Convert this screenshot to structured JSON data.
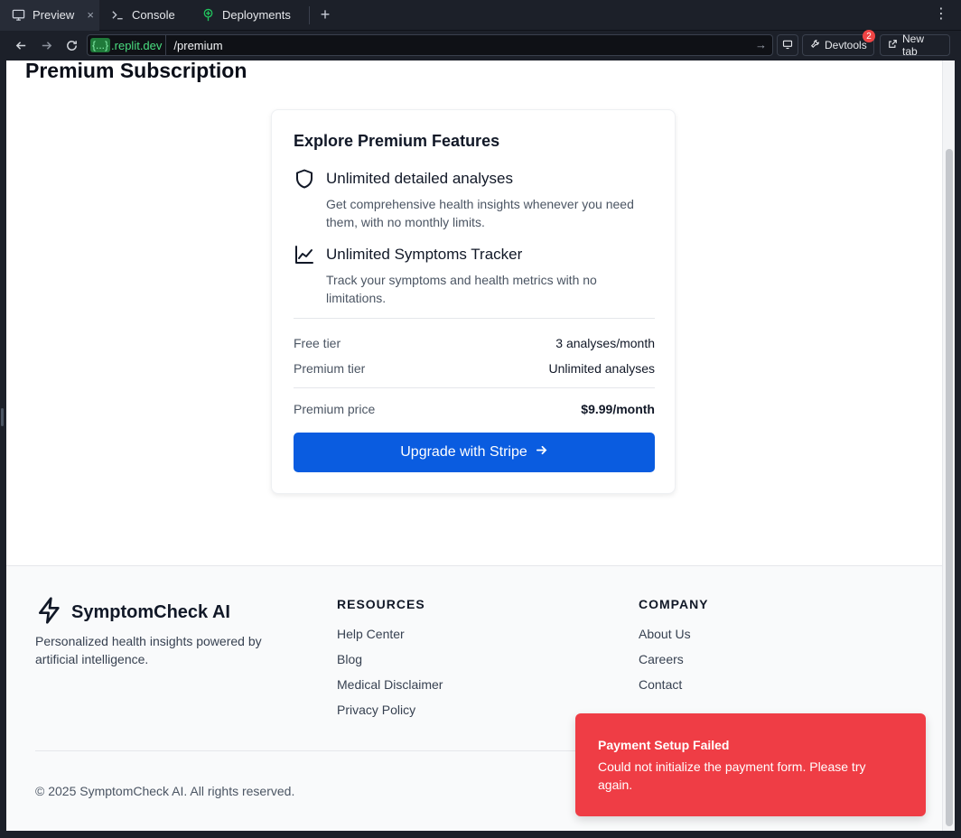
{
  "browser": {
    "tabs": [
      {
        "label": "Preview",
        "icon": "monitor-icon",
        "active": true
      },
      {
        "label": "Console",
        "icon": "terminal-icon",
        "active": false
      },
      {
        "label": "Deployments",
        "icon": "deployments-icon",
        "active": false
      }
    ],
    "close_symbol": "×",
    "new_tab_symbol": "+",
    "menu_symbol": "⋮",
    "domain_braces": "{...}",
    "domain": ".replit.dev",
    "path": "/premium",
    "devtools_label": "Devtools",
    "devtools_badge": "2",
    "new_tab_label": "New tab"
  },
  "page": {
    "title": "Premium Subscription",
    "card": {
      "title": "Explore Premium Features",
      "features": [
        {
          "icon": "shield-icon",
          "title": "Unlimited detailed analyses",
          "desc": "Get comprehensive health insights whenever you need them, with no monthly limits."
        },
        {
          "icon": "line-chart-icon",
          "title": "Unlimited Symptoms Tracker",
          "desc": "Track your symptoms and health metrics with no limitations."
        }
      ],
      "rows": [
        {
          "key": "Free tier",
          "value": "3 analyses/month"
        },
        {
          "key": "Premium tier",
          "value": "Unlimited analyses"
        }
      ],
      "price": {
        "key": "Premium price",
        "value": "$9.99/month"
      },
      "cta_label": "Upgrade with Stripe"
    }
  },
  "footer": {
    "brand": "SymptomCheck AI",
    "description": "Personalized health insights powered by artificial intelligence.",
    "resources": {
      "heading": "RESOURCES",
      "links": [
        "Help Center",
        "Blog",
        "Medical Disclaimer",
        "Privacy Policy"
      ]
    },
    "company": {
      "heading": "COMPANY",
      "links": [
        "About Us",
        "Careers",
        "Contact"
      ]
    },
    "copyright": "© 2025 SymptomCheck AI. All rights reserved."
  },
  "toast": {
    "title": "Payment Setup Failed",
    "message": "Could not initialize the payment form. Please try again.",
    "color": "#ef3d45"
  },
  "colors": {
    "accent": "#0a5ce0",
    "chrome": "#1c2029"
  }
}
